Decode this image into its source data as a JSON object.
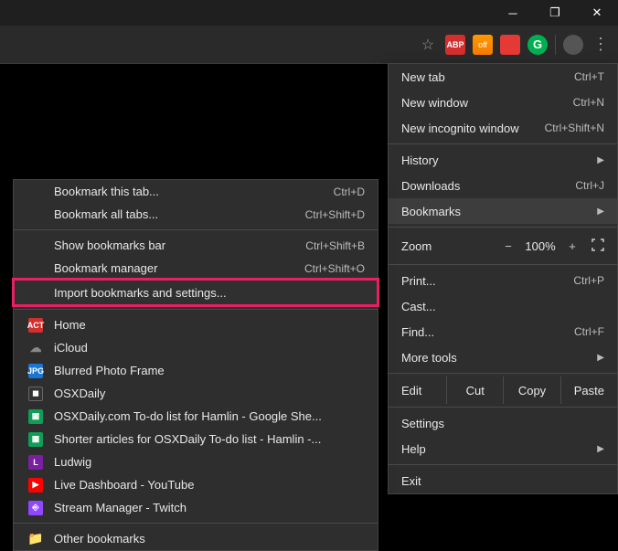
{
  "window_controls": {
    "min": "─",
    "max": "❐",
    "close": "✕"
  },
  "toolbar": {
    "star": "☆",
    "abp": "ABP",
    "honey": "off",
    "grammarly": "G",
    "dots": "⋮"
  },
  "main_menu": {
    "new_tab": {
      "label": "New tab",
      "shortcut": "Ctrl+T"
    },
    "new_window": {
      "label": "New window",
      "shortcut": "Ctrl+N"
    },
    "incognito": {
      "label": "New incognito window",
      "shortcut": "Ctrl+Shift+N"
    },
    "history": {
      "label": "History"
    },
    "downloads": {
      "label": "Downloads",
      "shortcut": "Ctrl+J"
    },
    "bookmarks": {
      "label": "Bookmarks"
    },
    "zoom": {
      "label": "Zoom",
      "minus": "−",
      "pct": "100%",
      "plus": "+"
    },
    "print": {
      "label": "Print...",
      "shortcut": "Ctrl+P"
    },
    "cast": {
      "label": "Cast..."
    },
    "find": {
      "label": "Find...",
      "shortcut": "Ctrl+F"
    },
    "more_tools": {
      "label": "More tools"
    },
    "edit": {
      "label": "Edit",
      "cut": "Cut",
      "copy": "Copy",
      "paste": "Paste"
    },
    "settings": {
      "label": "Settings"
    },
    "help": {
      "label": "Help"
    },
    "exit": {
      "label": "Exit"
    }
  },
  "bookmarks_menu": {
    "bm_tab": {
      "label": "Bookmark this tab...",
      "shortcut": "Ctrl+D"
    },
    "bm_all": {
      "label": "Bookmark all tabs...",
      "shortcut": "Ctrl+Shift+D"
    },
    "show_bar": {
      "label": "Show bookmarks bar",
      "shortcut": "Ctrl+Shift+B"
    },
    "manager": {
      "label": "Bookmark manager",
      "shortcut": "Ctrl+Shift+O"
    },
    "import": {
      "label": "Import bookmarks and settings..."
    },
    "items": [
      {
        "icon": "ACT",
        "cls": "fi-act",
        "label": "Home"
      },
      {
        "icon": "☁",
        "cls": "fi-cloud",
        "label": "iCloud"
      },
      {
        "icon": "JPG",
        "cls": "fi-jpg",
        "label": "Blurred Photo Frame"
      },
      {
        "icon": "◼",
        "cls": "fi-osx",
        "label": "OSXDaily"
      },
      {
        "icon": "▦",
        "cls": "fi-sheet",
        "label": "OSXDaily.com To-do list for Hamlin - Google She..."
      },
      {
        "icon": "▦",
        "cls": "fi-sheet",
        "label": "Shorter articles for OSXDaily To-do list - Hamlin -..."
      },
      {
        "icon": "L",
        "cls": "fi-ludwig",
        "label": "Ludwig"
      },
      {
        "icon": "▶",
        "cls": "fi-yt",
        "label": "Live Dashboard - YouTube"
      },
      {
        "icon": "⎆",
        "cls": "fi-tw",
        "label": "Stream Manager - Twitch"
      }
    ],
    "other": {
      "icon": "📁",
      "label": "Other bookmarks"
    }
  }
}
